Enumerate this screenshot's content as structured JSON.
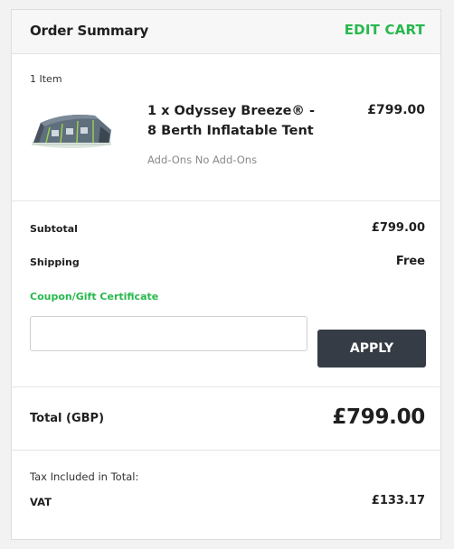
{
  "header": {
    "title": "Order Summary",
    "edit_label": "EDIT CART"
  },
  "items": {
    "count_label": "1 Item",
    "list": [
      {
        "name": "1 x Odyssey Breeze® - 8 Berth Inflatable Tent",
        "price": "£799.00",
        "addons": "Add-Ons No Add-Ons",
        "image_icon": "tent-product-image"
      }
    ]
  },
  "totals": {
    "subtotal_label": "Subtotal",
    "subtotal_value": "£799.00",
    "shipping_label": "Shipping",
    "shipping_value": "Free",
    "coupon_label": "Coupon/Gift Certificate",
    "coupon_value": "",
    "apply_label": "APPLY"
  },
  "grand_total": {
    "label": "Total (GBP)",
    "value": "£799.00"
  },
  "tax": {
    "note": "Tax Included in Total:",
    "vat_label": "VAT",
    "vat_value": "£133.17"
  },
  "colors": {
    "accent": "#27b84d",
    "button": "#363c45"
  }
}
